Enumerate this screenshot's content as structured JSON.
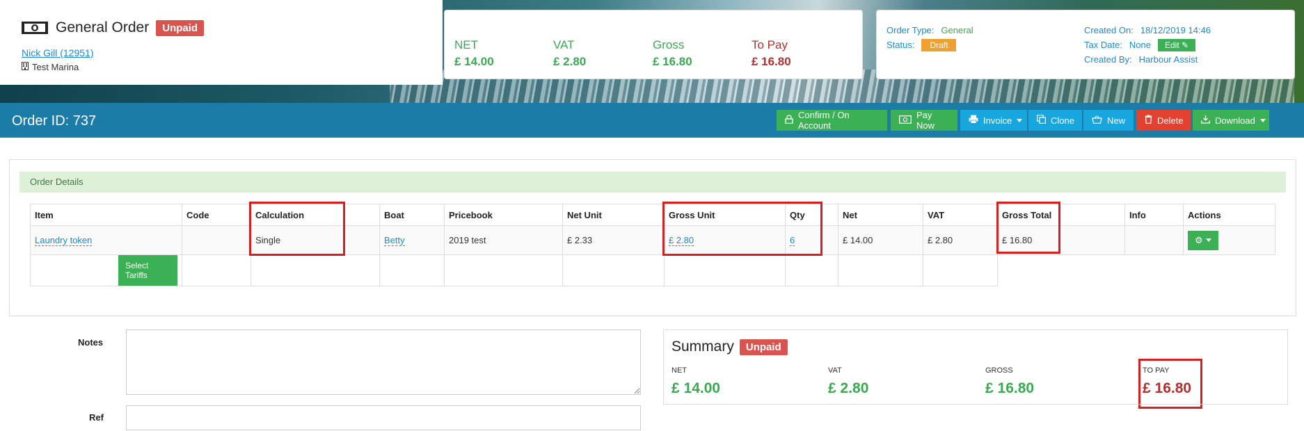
{
  "header": {
    "title": "General Order",
    "status_badge": "Unpaid",
    "customer_link": "Nick Gill (12951)",
    "marina": "Test Marina"
  },
  "totals": [
    {
      "label": "NET",
      "value": "£ 14.00",
      "color": "#3aaa52"
    },
    {
      "label": "VAT",
      "value": "£ 2.80",
      "color": "#3aaa52"
    },
    {
      "label": "Gross",
      "value": "£ 16.80",
      "color": "#3aaa52"
    },
    {
      "label": "To Pay",
      "value": "£ 16.80",
      "color": "#b03030"
    }
  ],
  "meta": {
    "order_type_label": "Order Type:",
    "order_type_value": "General",
    "status_label": "Status:",
    "status_value": "Draft",
    "created_on_label": "Created On:",
    "created_on_value": "18/12/2019 14:46",
    "tax_date_label": "Tax Date:",
    "tax_date_value": "None",
    "edit_label": "Edit",
    "created_by_label": "Created By:",
    "created_by_value": "Harbour Assist"
  },
  "toolbar": {
    "order_id": "Order ID: 737",
    "buttons": {
      "confirm": "Confirm / On Account",
      "pay_now": "Pay Now",
      "invoice": "Invoice",
      "clone": "Clone",
      "new": "New",
      "delete": "Delete",
      "download": "Download"
    }
  },
  "order_details": {
    "panel_title": "Order Details",
    "columns": [
      "Item",
      "Code",
      "Calculation",
      "Boat",
      "Pricebook",
      "Net Unit",
      "Gross Unit",
      "Qty",
      "Net",
      "VAT",
      "Gross Total",
      "Info",
      "Actions"
    ],
    "row": {
      "item": "Laundry token",
      "code": "",
      "calculation": "Single",
      "boat": "Betty",
      "pricebook": "2019 test",
      "net_unit": "£ 2.33",
      "gross_unit": "£ 2.80",
      "qty": "6",
      "net": "£ 14.00",
      "vat": "£ 2.80",
      "gross_total": "£ 16.80",
      "info": ""
    },
    "select_tariffs_label": "Select Tariffs"
  },
  "form": {
    "notes_label": "Notes",
    "notes_value": "",
    "ref_label": "Ref",
    "ref_value": ""
  },
  "summary": {
    "title": "Summary",
    "badge": "Unpaid",
    "items": [
      {
        "label": "NET",
        "value": "£ 14.00"
      },
      {
        "label": "VAT",
        "value": "£ 2.80"
      },
      {
        "label": "GROSS",
        "value": "£ 16.80"
      },
      {
        "label": "TO PAY",
        "value": "£ 16.80"
      }
    ]
  },
  "colors": {
    "accent_green": "#3cb054",
    "accent_blue": "#18a6de",
    "danger": "#e2412f",
    "header_bar": "#1c7ca8",
    "highlight": "#d42020"
  }
}
